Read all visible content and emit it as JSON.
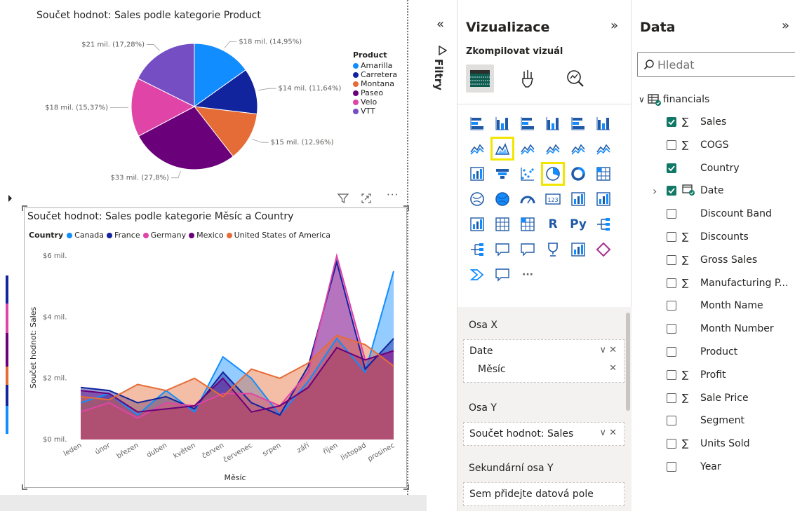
{
  "canvas": {
    "visual1": {
      "title": "Součet hodnot: Sales podle kategorie Product",
      "legend_title": "Product"
    },
    "visual2": {
      "title": "Součet hodnot: Sales podle kategorie Měsíc a Country",
      "legend_title": "Country",
      "y_axis_title": "Součet hodnot: Sales",
      "x_axis_title": "Měsíc"
    },
    "header_icons": [
      "filter-icon",
      "focus-mode-icon",
      "more-options-icon"
    ]
  },
  "chart_data": [
    {
      "type": "pie",
      "title": "Součet hodnot: Sales podle kategorie Product",
      "legend_title": "Product",
      "legend_position": "right",
      "slices": [
        {
          "name": "Amarilla",
          "value": 18,
          "label": "$18 mil. (14,95%)",
          "color": "#118DFF"
        },
        {
          "name": "Carretera",
          "value": 14,
          "label": "$14 mil. (11,64%)",
          "color": "#12239E"
        },
        {
          "name": "Montana",
          "value": 15,
          "label": "$15 mil. (12,96%)",
          "color": "#E66C37"
        },
        {
          "name": "Paseo",
          "value": 33,
          "label": "$33 mil. (27,8%)",
          "color": "#6B007B"
        },
        {
          "name": "Velo",
          "value": 18,
          "label": "$18 mil. (15,37%)",
          "color": "#E044A7"
        },
        {
          "name": "VTT",
          "value": 21,
          "label": "$21 mil. (17,28%)",
          "color": "#744EC2"
        }
      ]
    },
    {
      "type": "area",
      "title": "Součet hodnot: Sales podle kategorie Měsíc a Country",
      "legend_title": "Country",
      "legend_position": "top-left",
      "xlabel": "Měsíc",
      "ylabel": "Součet hodnot: Sales",
      "ylim": [
        0,
        6
      ],
      "y_ticks": [
        "$0 mil.",
        "$2 mil.",
        "$4 mil.",
        "$6 mil."
      ],
      "grid": false,
      "categories": [
        "leden",
        "únor",
        "březen",
        "duben",
        "květen",
        "červen",
        "červenec",
        "srpen",
        "září",
        "říjen",
        "listopad",
        "prosinec"
      ],
      "series": [
        {
          "name": "Canada",
          "color": "#118DFF",
          "values": [
            1.2,
            1.5,
            0.8,
            1.6,
            0.9,
            2.7,
            2.0,
            0.8,
            1.9,
            3.3,
            2.2,
            5.5
          ]
        },
        {
          "name": "France",
          "color": "#12239E",
          "values": [
            1.7,
            1.6,
            1.2,
            1.4,
            1.0,
            2.2,
            1.2,
            0.8,
            2.4,
            5.8,
            2.3,
            3.3
          ]
        },
        {
          "name": "Germany",
          "color": "#E044A7",
          "values": [
            0.9,
            1.2,
            0.7,
            1.2,
            1.1,
            1.5,
            1.5,
            1.1,
            2.2,
            6.0,
            2.6,
            2.9
          ]
        },
        {
          "name": "Mexico",
          "color": "#6B007B",
          "values": [
            1.6,
            1.5,
            0.9,
            1.0,
            1.1,
            2.0,
            0.9,
            1.1,
            1.7,
            3.0,
            2.6,
            2.9
          ]
        },
        {
          "name": "United States of America",
          "color": "#E66C37",
          "values": [
            1.4,
            1.3,
            1.8,
            1.6,
            2.0,
            1.4,
            2.3,
            2.0,
            2.5,
            3.4,
            3.1,
            2.4
          ]
        }
      ]
    }
  ],
  "filters_pane": {
    "label": "Filtry",
    "collapse_icon": "collapse-left-icon"
  },
  "viz_pane": {
    "title": "Vizualizace",
    "build_label": "Zkompilovat vizuál",
    "gallery_more": "...",
    "wells": {
      "x_axis_label": "Osa X",
      "x_field_1": "Date",
      "x_field_2": "Měsíc",
      "y_axis_label": "Osa Y",
      "y_field": "Součet hodnot: Sales",
      "secondary_y_label": "Sekundární osa Y",
      "secondary_placeholder": "Sem přidejte datová pole"
    }
  },
  "data_pane": {
    "title": "Data",
    "search_placeholder": "Hledat",
    "table_name": "financials",
    "fields": [
      {
        "label": "Sales",
        "checked": true,
        "sigma": true
      },
      {
        "label": "COGS",
        "checked": false,
        "sigma": true
      },
      {
        "label": "Country",
        "checked": true,
        "sigma": false
      },
      {
        "label": "Date",
        "checked": true,
        "sigma": false,
        "date": true
      },
      {
        "label": "Discount Band",
        "checked": false,
        "sigma": false
      },
      {
        "label": "Discounts",
        "checked": false,
        "sigma": true
      },
      {
        "label": "Gross Sales",
        "checked": false,
        "sigma": true
      },
      {
        "label": "Manufacturing P...",
        "checked": false,
        "sigma": true
      },
      {
        "label": "Month Name",
        "checked": false,
        "sigma": false
      },
      {
        "label": "Month Number",
        "checked": false,
        "sigma": false
      },
      {
        "label": "Product",
        "checked": false,
        "sigma": false
      },
      {
        "label": "Profit",
        "checked": false,
        "sigma": true
      },
      {
        "label": "Sale Price",
        "checked": false,
        "sigma": true
      },
      {
        "label": "Segment",
        "checked": false,
        "sigma": false
      },
      {
        "label": "Units Sold",
        "checked": false,
        "sigma": true
      },
      {
        "label": "Year",
        "checked": false,
        "sigma": false
      }
    ]
  }
}
